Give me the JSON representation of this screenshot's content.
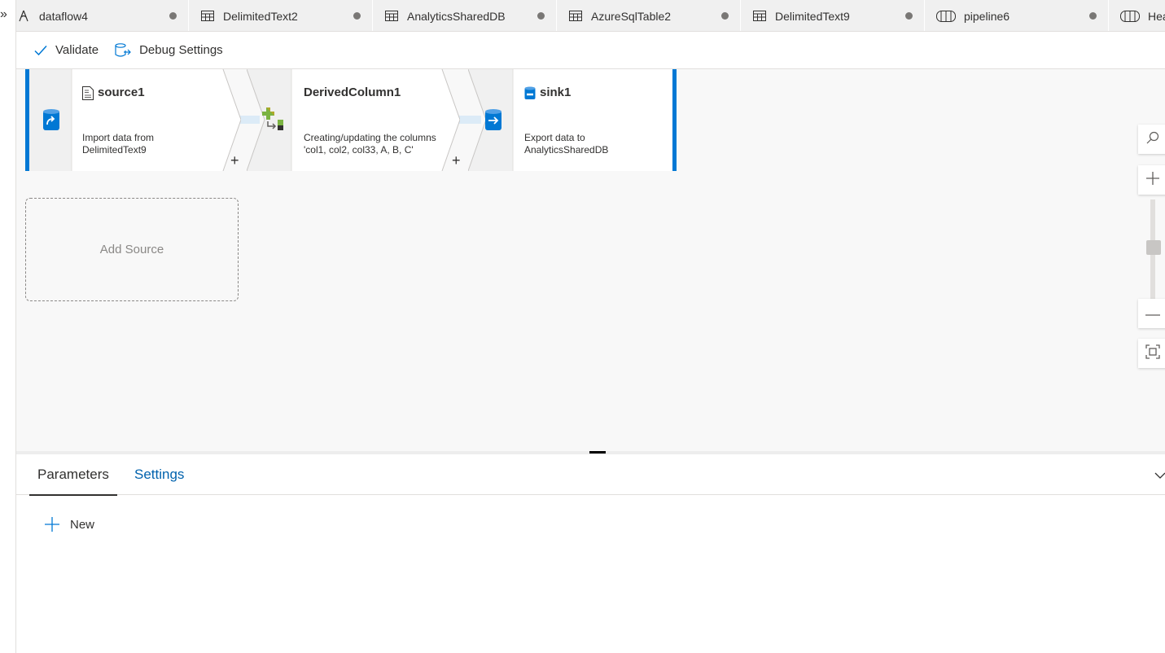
{
  "tabs": [
    {
      "label": "dataflow4",
      "icon": "dataflow-icon"
    },
    {
      "label": "DelimitedText2",
      "icon": "table-icon"
    },
    {
      "label": "AnalyticsSharedDB",
      "icon": "table-icon"
    },
    {
      "label": "AzureSqlTable2",
      "icon": "table-icon"
    },
    {
      "label": "DelimitedText9",
      "icon": "table-icon"
    },
    {
      "label": "pipeline6",
      "icon": "pipeline-icon"
    },
    {
      "label": "Hea",
      "icon": "pipeline-icon"
    }
  ],
  "toolbar": {
    "validate_label": "Validate",
    "debug_label": "Debug Settings"
  },
  "nodes": [
    {
      "title": "source1",
      "desc_line1": "Import data from",
      "desc_line2": "DelimitedText9"
    },
    {
      "title": "DerivedColumn1",
      "desc_line1": "Creating/updating the columns",
      "desc_line2": "'col1, col2, col33, A, B, C'"
    },
    {
      "title": "sink1",
      "desc_line1": "Export data to",
      "desc_line2": "AnalyticsSharedDB"
    }
  ],
  "add_source_label": "Add Source",
  "add_glyph": "+",
  "panel": {
    "tabs": [
      {
        "label": "Parameters",
        "active": true
      },
      {
        "label": "Settings",
        "active": false
      }
    ],
    "new_label": "New"
  },
  "colors": {
    "accent": "#0078d4",
    "link": "#0062ad",
    "tab_bar": "#f0f0f0",
    "canvas": "#f8f8f8"
  }
}
